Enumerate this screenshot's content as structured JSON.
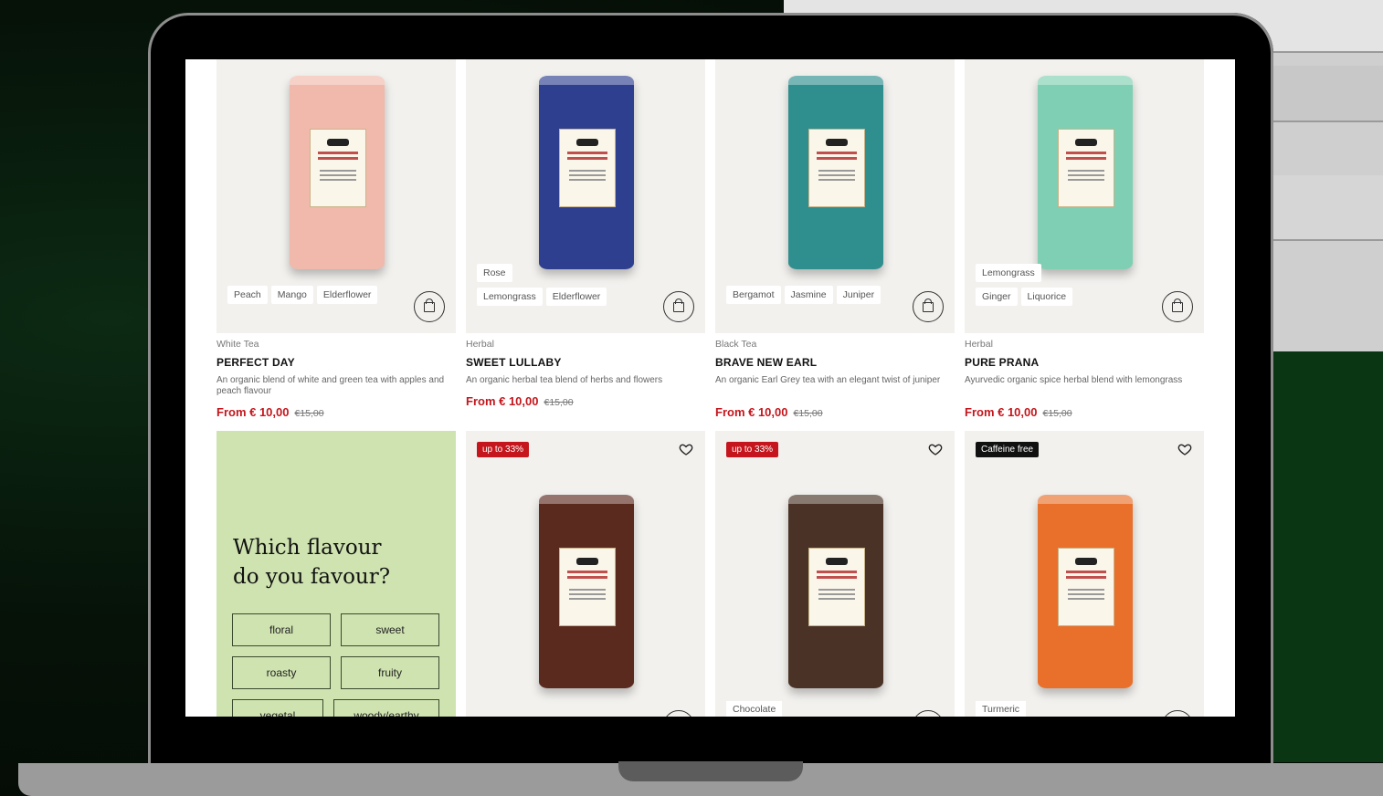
{
  "products": [
    {
      "category": "White Tea",
      "name": "PERFECT DAY",
      "description": "An organic blend of white and green tea with apples and peach flavour",
      "price": "From € 10,00",
      "old_price": "€15,00",
      "tags": [
        "Peach",
        "Mango",
        "Elderflower"
      ],
      "can_color": "#f0b9ab"
    },
    {
      "category": "Herbal",
      "name": "SWEET LULLABY",
      "description": "An organic herbal tea blend of herbs and flowers",
      "price": "From € 10,00",
      "old_price": "€15,00",
      "tags": [
        "Rose",
        "Lemongrass",
        "Elderflower"
      ],
      "can_color": "#2f3f8f"
    },
    {
      "category": "Black Tea",
      "name": "BRAVE NEW EARL",
      "description": "An organic Earl Grey tea with an elegant twist of juniper",
      "price": "From € 10,00",
      "old_price": "€15,00",
      "tags": [
        "Bergamot",
        "Jasmine",
        "Juniper"
      ],
      "can_color": "#2f8f8f"
    },
    {
      "category": "Herbal",
      "name": "PURE PRANA",
      "description": "Ayurvedic organic spice herbal blend with lemongrass",
      "price": "From € 10,00",
      "old_price": "€15,00",
      "tags": [
        "Lemongrass",
        "Ginger",
        "Liquorice"
      ],
      "can_color": "#7ecfb3"
    }
  ],
  "quiz": {
    "title_line1": "Which flavour",
    "title_line2": "do you favour?",
    "options": [
      "floral",
      "sweet",
      "roasty",
      "fruity",
      "vegetal",
      "woody/earthy"
    ]
  },
  "row2": [
    {
      "badge": "up to 33%",
      "badge_color": "#c4161c",
      "can_color": "#5b2a1f",
      "tag": ""
    },
    {
      "badge": "up to 33%",
      "badge_color": "#c4161c",
      "can_color": "#4a3326",
      "tag": "Chocolate"
    },
    {
      "badge": "Caffeine free",
      "badge_color": "#111111",
      "can_color": "#e8702a",
      "tag": "Turmeric"
    }
  ]
}
